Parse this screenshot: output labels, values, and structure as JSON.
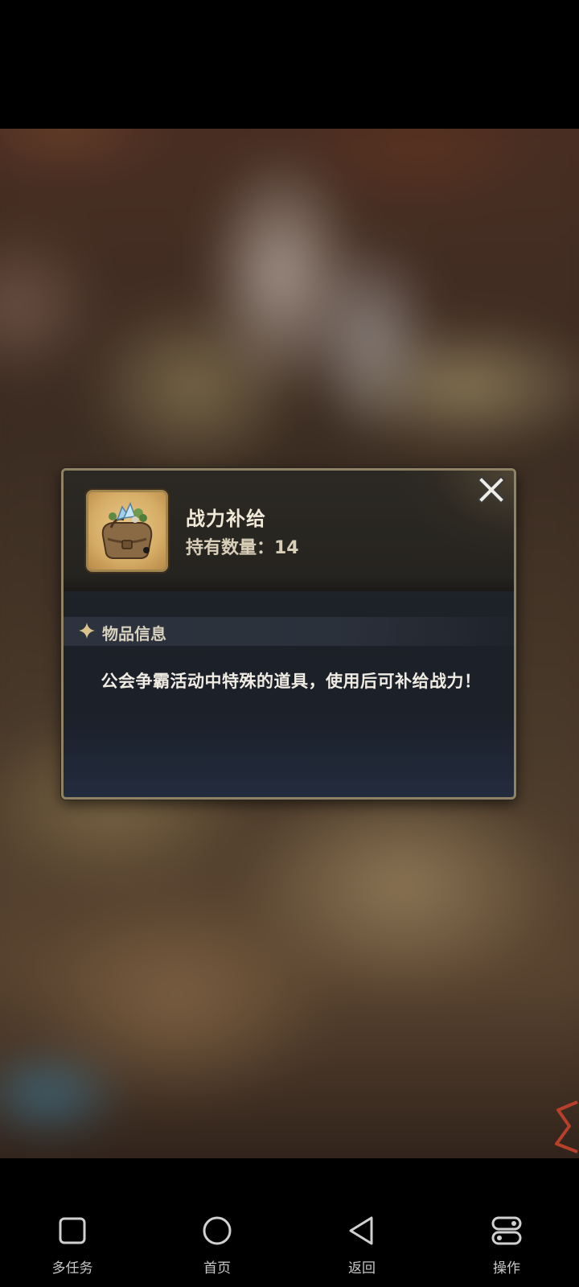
{
  "item_dialog": {
    "name": "战力补给",
    "quantity_text": "持有数量：14",
    "section_title": "物品信息",
    "description": "公会争霸活动中特殊的道具，使用后可补给战力！",
    "close_icon": "close-x-icon"
  },
  "navbar": {
    "items": [
      {
        "label": "多任务",
        "icon": "square-icon"
      },
      {
        "label": "首页",
        "icon": "circle-icon"
      },
      {
        "label": "返回",
        "icon": "triangle-back-icon"
      },
      {
        "label": "操作",
        "icon": "toggle-icon"
      }
    ]
  },
  "colors": {
    "dialog_border": "#8f8265",
    "dialog_bg": "#1d2128",
    "title_text": "#f2ead8",
    "nav_text": "#c8c8c8"
  }
}
